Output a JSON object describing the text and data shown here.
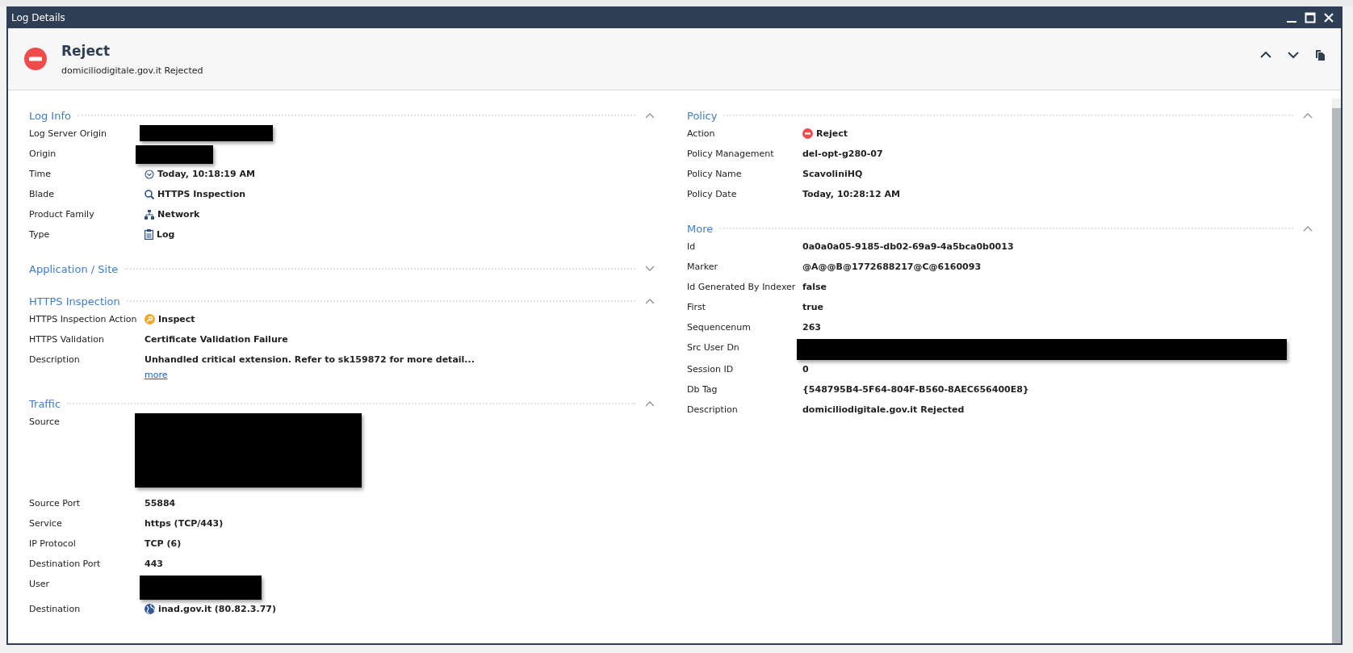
{
  "window": {
    "title": "Log Details"
  },
  "header": {
    "title": "Reject",
    "subtitle": "domiciliodigitale.gov.it Rejected"
  },
  "columns": [
    [
      {
        "title": "Log Info",
        "expanded": true,
        "rows": [
          {
            "label": "Log Server Origin",
            "kind": "redacted"
          },
          {
            "label": "Origin",
            "kind": "redacted"
          },
          {
            "label": "Time",
            "kind": "time",
            "value": "Today, 10:18:19 AM"
          },
          {
            "label": "Blade",
            "kind": "blade",
            "value": "HTTPS Inspection"
          },
          {
            "label": "Product Family",
            "kind": "family",
            "value": "Network"
          },
          {
            "label": "Type",
            "kind": "type",
            "value": "Log"
          }
        ]
      },
      {
        "title": "Application / Site",
        "expanded": false
      },
      {
        "title": "HTTPS Inspection",
        "expanded": true,
        "rows": [
          {
            "label": "HTTPS Inspection Action",
            "kind": "inspect",
            "value": "Inspect"
          },
          {
            "label": "HTTPS Validation",
            "kind": "text",
            "value": "Certificate Validation Failure"
          },
          {
            "label": "Description",
            "kind": "text",
            "value": "Unhandled critical extension. Refer to sk159872 for more detail...",
            "link": "more"
          }
        ]
      },
      {
        "title": "Traffic",
        "expanded": true,
        "rows": [
          {
            "label": "Source",
            "kind": "redacted"
          },
          {
            "label": "Source Port",
            "kind": "text",
            "value": "55884"
          },
          {
            "label": "Service",
            "kind": "text",
            "value": "https (TCP/443)"
          },
          {
            "label": "IP Protocol",
            "kind": "text",
            "value": "TCP (6)"
          },
          {
            "label": "Destination Port",
            "kind": "text",
            "value": "443"
          },
          {
            "label": "User",
            "kind": "redacted"
          },
          {
            "label": "Destination",
            "kind": "destination",
            "value": "inad.gov.it (80.82.3.77)"
          }
        ]
      }
    ],
    [
      {
        "title": "Policy",
        "expanded": true,
        "rows": [
          {
            "label": "Action",
            "kind": "action",
            "value": "Reject"
          },
          {
            "label": "Policy Management",
            "kind": "text",
            "value": "del-opt-g280-07"
          },
          {
            "label": "Policy Name",
            "kind": "text",
            "value": "ScavoliniHQ"
          },
          {
            "label": "Policy Date",
            "kind": "text",
            "value": "Today, 10:28:12 AM"
          }
        ]
      },
      {
        "title": "More",
        "expanded": true,
        "rows": [
          {
            "label": "Id",
            "kind": "text",
            "value": "0a0a0a05-9185-db02-69a9-4a5bca0b0013"
          },
          {
            "label": "Marker",
            "kind": "text",
            "value": "@A@@B@1772688217@C@6160093"
          },
          {
            "label": "Id Generated By Indexer",
            "kind": "text",
            "value": "false"
          },
          {
            "label": "First",
            "kind": "text",
            "value": "true"
          },
          {
            "label": "Sequencenum",
            "kind": "text",
            "value": "263"
          },
          {
            "label": "Src User Dn",
            "kind": "redacted"
          },
          {
            "label": "Session ID",
            "kind": "text",
            "value": "0"
          },
          {
            "label": "Db Tag",
            "kind": "text",
            "value": "{548795B4-5F64-804F-B560-8AEC656400E8}"
          },
          {
            "label": "Description",
            "kind": "text",
            "value": "domiciliodigitale.gov.it Rejected"
          }
        ]
      }
    ]
  ]
}
